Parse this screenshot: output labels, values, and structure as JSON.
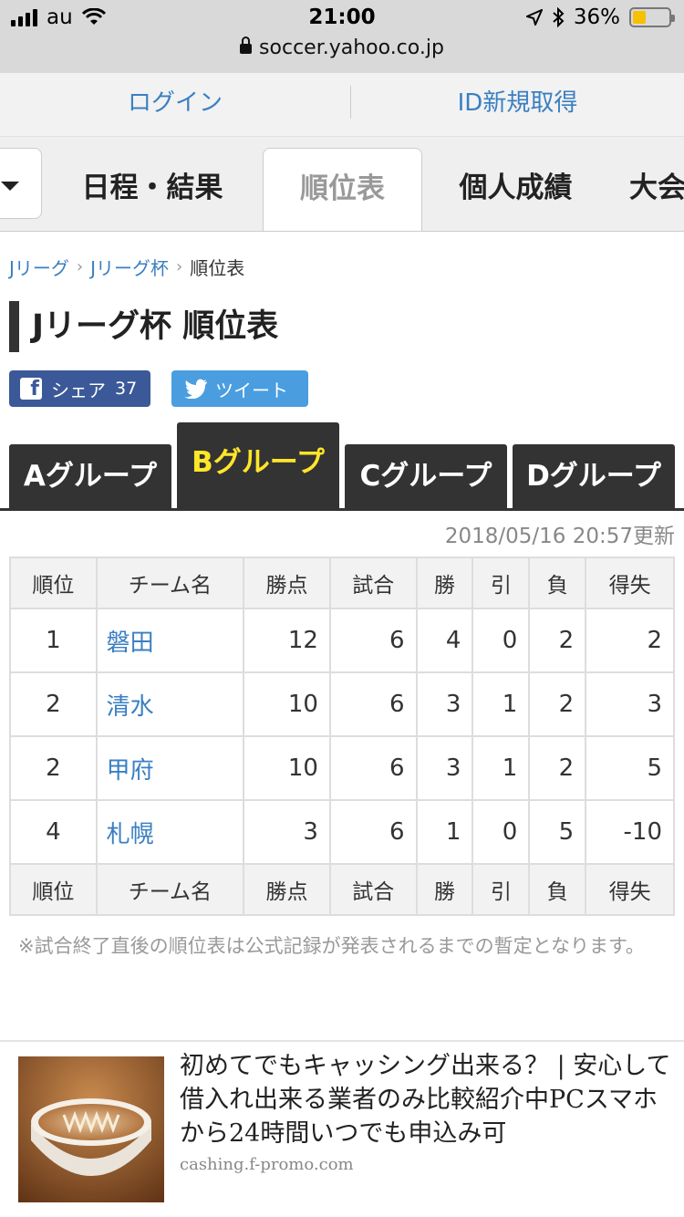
{
  "status": {
    "carrier": "au",
    "time": "21:00",
    "battery": "36%",
    "battery_level": 0.36,
    "url": "soccer.yahoo.co.jp"
  },
  "auth": {
    "login": "ログイン",
    "register": "ID新規取得"
  },
  "nav": {
    "tabs": [
      "日程・結果",
      "順位表",
      "個人成績",
      "大会"
    ],
    "active": "順位表"
  },
  "breadcrumb": [
    "Jリーグ",
    "Jリーグ杯",
    "順位表"
  ],
  "title": "Jリーグ杯 順位表",
  "share": {
    "facebook": "シェア",
    "facebook_count": "37",
    "twitter": "ツイート"
  },
  "groups": [
    "Aグループ",
    "Bグループ",
    "Cグループ",
    "Dグループ"
  ],
  "active_group": "Bグループ",
  "updated": "2018/05/16 20:57更新",
  "table": {
    "headers": [
      "順位",
      "チーム名",
      "勝点",
      "試合",
      "勝",
      "引",
      "負",
      "得失"
    ],
    "rows": [
      [
        "1",
        "磐田",
        "12",
        "6",
        "4",
        "0",
        "2",
        "2"
      ],
      [
        "2",
        "清水",
        "10",
        "6",
        "3",
        "1",
        "2",
        "3"
      ],
      [
        "2",
        "甲府",
        "10",
        "6",
        "3",
        "1",
        "2",
        "5"
      ],
      [
        "4",
        "札幌",
        "3",
        "6",
        "1",
        "0",
        "5",
        "-10"
      ]
    ]
  },
  "note": "※試合終了直後の順位表は公式記録が発表されるまでの暫定となります。",
  "ad": {
    "title": "初めてでもキャッシング出来る？ | 安心して借入れ出来る業者のみ比較紹介中PCスマホから24時間いつでも申込み可",
    "url": "cashing.f-promo.com"
  },
  "colors": {
    "link": "#3a7fc2",
    "tab_dark": "#333333",
    "tab_active_text": "#ffe629",
    "facebook": "#3b5998",
    "twitter": "#4a9ee0"
  }
}
